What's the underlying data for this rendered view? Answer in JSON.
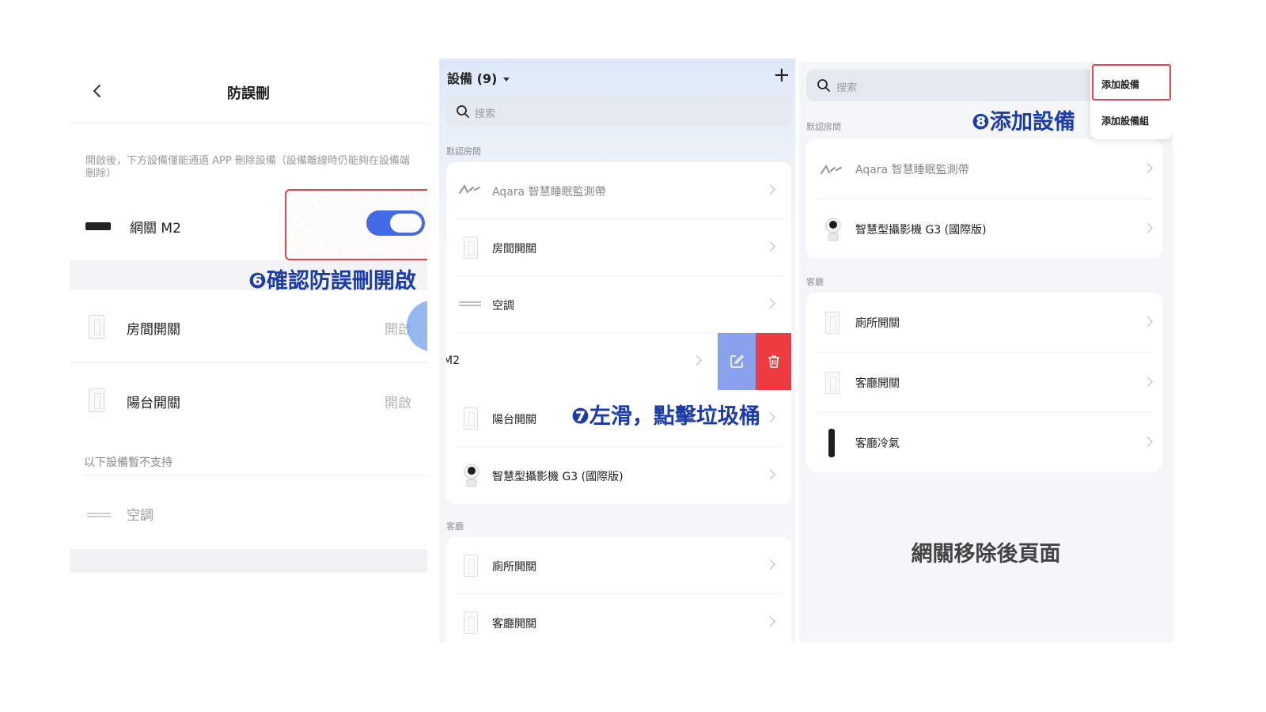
{
  "panel1": {
    "title": "防誤刪",
    "description": "開啟後，下方設備僅能通過 APP 刪除設備（設備離線時仍能夠在設備端刪除）",
    "gateway": {
      "label": "網關 M2",
      "toggle_on": true
    },
    "rows": [
      {
        "label": "房間開關",
        "status": "開啟"
      },
      {
        "label": "陽台開關",
        "status": "開啟"
      }
    ],
    "unsupported_note": "以下設備暫不支持",
    "unsupported": [
      {
        "label": "空調"
      }
    ],
    "toggle_color": "#3f6ae8"
  },
  "annotations": {
    "step6": "❻確認防誤刪開啟",
    "step7": "❼左滑，點擊垃圾桶",
    "step8": "❽添加設備",
    "color": "#1c3ca8"
  },
  "panel2": {
    "header": "設備 (9)",
    "add_icon": "plus-icon",
    "search_placeholder": "搜索",
    "section_default": "默認房間",
    "section_living": "客廳",
    "default_items": [
      {
        "name": "Aqara 智慧睡眠監測帶",
        "icon": "sleep-belt-icon",
        "dim": true
      },
      {
        "name": "房間開關",
        "icon": "wall-switch-icon"
      },
      {
        "name": "空調",
        "icon": "ac-icon"
      },
      {
        "name": "M2",
        "icon": "gateway-icon",
        "swiped": true
      },
      {
        "name": "陽台開關",
        "icon": "wall-switch-icon"
      },
      {
        "name": "智慧型攝影機 G3 (國際版)",
        "icon": "camera-icon"
      }
    ],
    "living_items": [
      {
        "name": "廁所開關",
        "icon": "wall-switch-icon"
      },
      {
        "name": "客廳開關",
        "icon": "wall-switch-icon"
      }
    ],
    "edit_color": "#8aa2ee",
    "delete_color": "#ee3b3f"
  },
  "panel3": {
    "search_placeholder": "搜索",
    "menu": {
      "add_device": "添加設備",
      "add_device_group": "添加設備組"
    },
    "section_default": "默認房間",
    "section_living": "客廳",
    "default_items": [
      {
        "name": "Aqara 智慧睡眠監測帶",
        "icon": "sleep-belt-icon",
        "dim": true
      },
      {
        "name": "智慧型攝影機 G3 (國際版)",
        "icon": "camera-icon"
      }
    ],
    "living_items": [
      {
        "name": "廁所開關",
        "icon": "wall-switch-icon"
      },
      {
        "name": "客廳開關",
        "icon": "wall-switch-icon"
      },
      {
        "name": "客廳冷氣",
        "icon": "remote-icon"
      }
    ],
    "caption": "網關移除後頁面",
    "highlight_color": "#e0454a"
  }
}
